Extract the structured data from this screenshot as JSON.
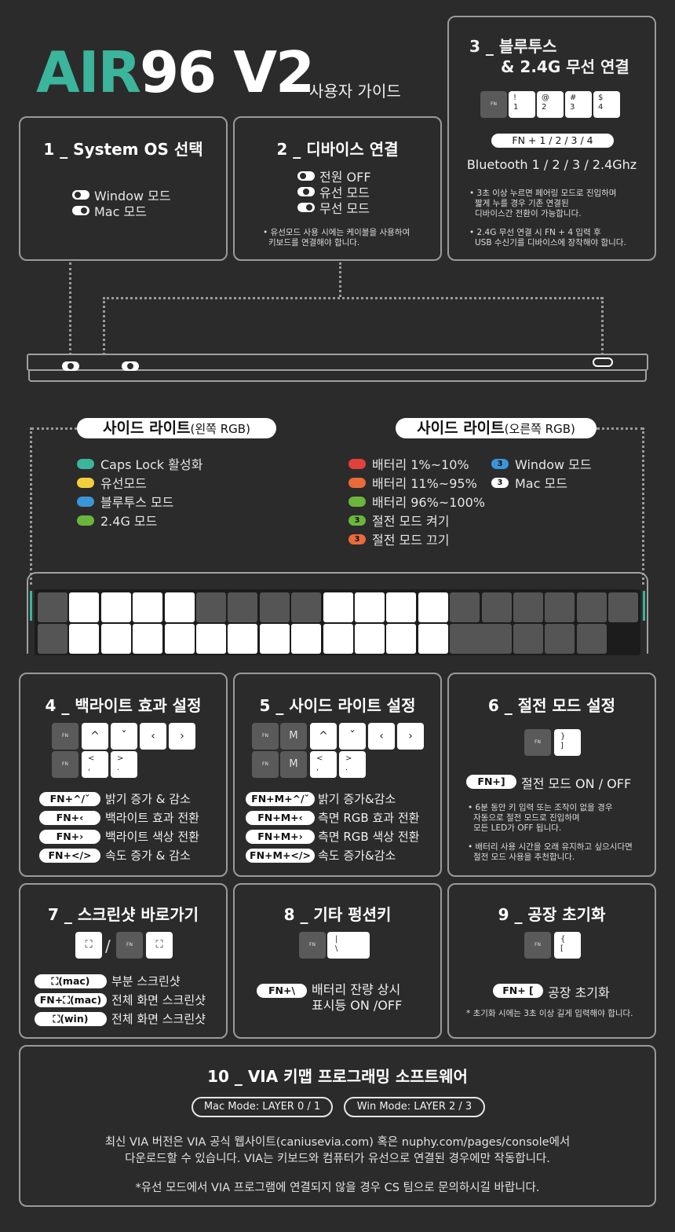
{
  "header": {
    "brand_accent": "AIR",
    "brand_main": "96 V2",
    "subtitle": "사용자 가이드"
  },
  "colors": {
    "accent": "#3bb59b",
    "background": "#2b2b2b",
    "teal": "#3bb59b",
    "yellow": "#f2d03b",
    "blue": "#3b95d9",
    "green": "#6ab63c",
    "red": "#e2413b",
    "orange": "#ea6a3a"
  },
  "section1": {
    "title": "1 _ System OS 선택",
    "items": [
      "Window 모드",
      "Mac 모드"
    ]
  },
  "section2": {
    "title": "2 _ 디바이스 연결",
    "items": [
      "전원 OFF",
      "유선 모드",
      "무선 모드"
    ],
    "note_line1": "• 유선모드 사용 시에는 케이블을 사용하여",
    "note_line2": "키보드를 연결해야 합니다."
  },
  "section3": {
    "title_line1": "3 _ 블루투스",
    "title_line2": "& 2.4G 무선 연결",
    "keys": [
      {
        "top": "FN",
        "bottom": ""
      },
      {
        "top": "!",
        "bottom": "1"
      },
      {
        "top": "@",
        "bottom": "2"
      },
      {
        "top": "#",
        "bottom": "3"
      },
      {
        "top": "$",
        "bottom": "4"
      }
    ],
    "pill": "FN + 1 / 2 / 3 / 4",
    "desc": "Bluetooth 1 / 2 / 3 / 2.4Ghz",
    "note1_line1": "• 3초 이상 누르면 페어링 모드로 진입하며",
    "note1_line2": "짧게 누를 경우 기존 연결된",
    "note1_line3": "디바이스간 전환이 가능합니다.",
    "note2_line1": "• 2.4G 무선 연결 시 FN + 4 입력 후",
    "note2_line2": "USB 수신기를 디바이스에 장착해야 합니다."
  },
  "side_light": {
    "left_title": "사이드 라이트",
    "left_title_sub": "(왼쪽 RGB)",
    "right_title": "사이드 라이트",
    "right_title_sub": "(오른쪽 RGB)",
    "left_items": [
      {
        "label": "Caps Lock 활성화",
        "color": "#3bb59b"
      },
      {
        "label": "유선모드",
        "color": "#f2d03b"
      },
      {
        "label": "블루투스 모드",
        "color": "#3b95d9"
      },
      {
        "label": "2.4G 모드",
        "color": "#6ab63c"
      }
    ],
    "right_items": [
      {
        "label": "배터리 1%~10%",
        "color": "#e2413b",
        "badge": ""
      },
      {
        "label": "배터리 11%~95%",
        "color": "#ea6a3a",
        "badge": ""
      },
      {
        "label": "배터리 96%~100%",
        "color": "#6ab63c",
        "badge": ""
      },
      {
        "label": "절전 모드 켜기",
        "color": "#6ab63c",
        "badge": "3"
      },
      {
        "label": "절전 모드 끄기",
        "color": "#ea6a3a",
        "badge": "3"
      }
    ],
    "right_items2": [
      {
        "label": "Window 모드",
        "color": "#3b95d9",
        "badge": "3"
      },
      {
        "label": "Mac 모드",
        "color": "#ffffff",
        "badge": "3"
      }
    ]
  },
  "section4": {
    "title": "4 _ 백라이트 효과 설정",
    "keys_row1": [
      "FN",
      "^",
      "ˇ",
      "‹",
      "›"
    ],
    "keys_row2": [
      "FN",
      "<\n,",
      ">\n."
    ],
    "rows": [
      {
        "pill": "FN+^/ˇ",
        "desc": "밝기 증가 & 감소"
      },
      {
        "pill": "FN+‹",
        "desc": "백라이트 효과 전환"
      },
      {
        "pill": "FN+›",
        "desc": "백라이트 색상 전환"
      },
      {
        "pill": "FN+</>",
        "desc": "속도 증가 & 감소"
      }
    ]
  },
  "section5": {
    "title": "5 _ 사이드 라이트 설정",
    "keys_row1": [
      "FN",
      "M",
      "^",
      "ˇ",
      "‹",
      "›"
    ],
    "keys_row2": [
      "FN",
      "M",
      "<\n,",
      ">\n."
    ],
    "rows": [
      {
        "pill": "FN+M+^/ˇ",
        "desc": "밝기 증가&감소"
      },
      {
        "pill": "FN+M+‹",
        "desc": "측면 RGB 효과 전환"
      },
      {
        "pill": "FN+M+›",
        "desc": "측면 RGB 색상 전환"
      },
      {
        "pill": "FN+M+</>",
        "desc": "속도 증가&감소"
      }
    ]
  },
  "section6": {
    "title": "6 _ 절전 모드 설정",
    "keys": [
      "FN",
      "}\n]"
    ],
    "pill": "FN+]",
    "desc": "절전 모드 ON / OFF",
    "note1_line1": "• 6분 동안 키 입력 또는 조작이 없을 경우",
    "note1_line2": "자동으로 절전 모드로 진입하며",
    "note1_line3": "모든 LED가 OFF 됩니다.",
    "note2_line1": "• 배터리 사용 시간을 오래 유지하고 싶으시다면",
    "note2_line2": "절전 모드 사용을 추천합니다."
  },
  "section7": {
    "title": "7 _ 스크린샷 바로가기",
    "slash": "/",
    "rows": [
      {
        "pill": "⛶(mac)",
        "desc": "부분 스크린샷"
      },
      {
        "pill": "FN+⛶(mac)",
        "desc": "전체 화면 스크린샷"
      },
      {
        "pill": "⛶(win)",
        "desc": "전체 화면 스크린샷"
      }
    ]
  },
  "section8": {
    "title": "8 _ 기타 펑션키",
    "keys": [
      "FN",
      "|\n\\"
    ],
    "pill": "FN+\\",
    "desc_line1": "배터리 잔량 상시",
    "desc_line2": "표시등 ON /OFF"
  },
  "section9": {
    "title": "9 _ 공장 초기화",
    "keys": [
      "FN",
      "{\n["
    ],
    "pill": "FN+ [",
    "desc": "공장 초기화",
    "note": "* 초기화 시에는 3초 이상 길게 입력해야 합니다."
  },
  "section10": {
    "title": "10 _ VIA 키맵 프로그래밍 소프트웨어",
    "mac_mode": "Mac Mode: LAYER 0 / 1",
    "win_mode": "Win Mode: LAYER 2 / 3",
    "body_line1": "최신 VIA 버전은 VIA 공식 웹사이트(caniusevia.com) 혹은 nuphy.com/pages/console에서",
    "body_line2": "다운로드할 수 있습니다. VIA는 키보드와 컴퓨터가 유선으로 연결된 경우에만 작동합니다.",
    "footnote": "*유선 모드에서 VIA 프로그램에 연결되지 않을 경우 CS 팀으로 문의하시길 바랍니다."
  }
}
